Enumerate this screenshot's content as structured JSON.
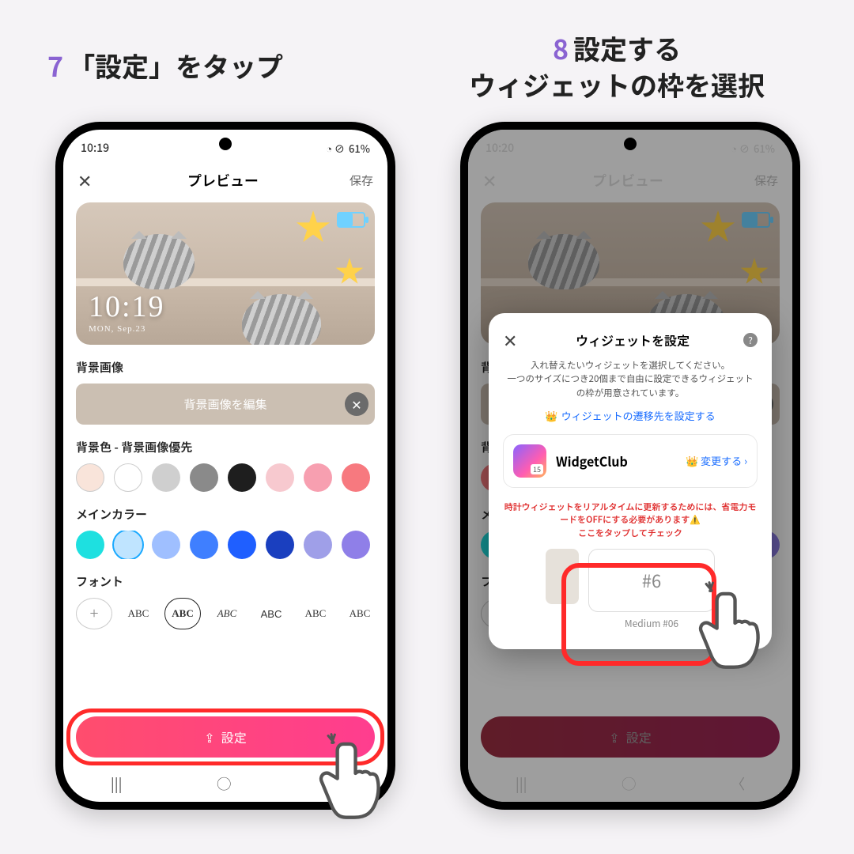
{
  "captions": {
    "step7_num": "7",
    "step7_text": "「設定」をタップ",
    "step8_num": "8",
    "step8_line1": "設定する",
    "step8_line2": "ウィジェットの枠を選択"
  },
  "status": {
    "time_left": "10:19",
    "time_right": "10:20",
    "battery": "61%",
    "icons_left": "◂ ◗ ▷",
    "icons_right": "◔ ⊘"
  },
  "app": {
    "title": "プレビュー",
    "save": "保存",
    "widget_clock_time": "10:19",
    "widget_clock_date": "MON, Sep.23",
    "labels": {
      "bg_image": "背景画像",
      "bg_edit": "背景画像を編集",
      "bg_color": "背景色 - 背景画像優先",
      "main_color": "メインカラー",
      "font": "フォント"
    },
    "font_sample": "ABC",
    "settei_button": "設定",
    "bg_colors": [
      "#f9e4da",
      "#ffffff",
      "#cfcfcf",
      "#8a8a8a",
      "#1e1e1e",
      "#f7c9cf",
      "#f79fb0",
      "#f7797f"
    ],
    "main_colors": [
      "#1ee0e0",
      "#bfe4ff",
      "#9fbfff",
      "#3f7fff",
      "#1f5fff",
      "#1a3fbf",
      "#9f9fe8",
      "#8f7fe8"
    ],
    "selected_main_index": 1
  },
  "nav": {
    "recent": "|||",
    "home": "◯",
    "back": "〈"
  },
  "modal": {
    "title": "ウィジェットを設定",
    "desc1": "入れ替えたいウィジェットを選択してください。",
    "desc2": "一つのサイズにつき20個まで自由に設定できるウィジェットの枠が用意されています。",
    "link": "ウィジェットの遷移先を設定する",
    "widgetclub": "WidgetClub",
    "change": "変更する",
    "warn1": "時計ウィジェットをリアルタイムに更新するためには、省電力モードをOFFにする必要があります⚠️",
    "warn2": "ここをタップしてチェック",
    "slot_number": "#6",
    "slot_label": "Medium #06"
  }
}
